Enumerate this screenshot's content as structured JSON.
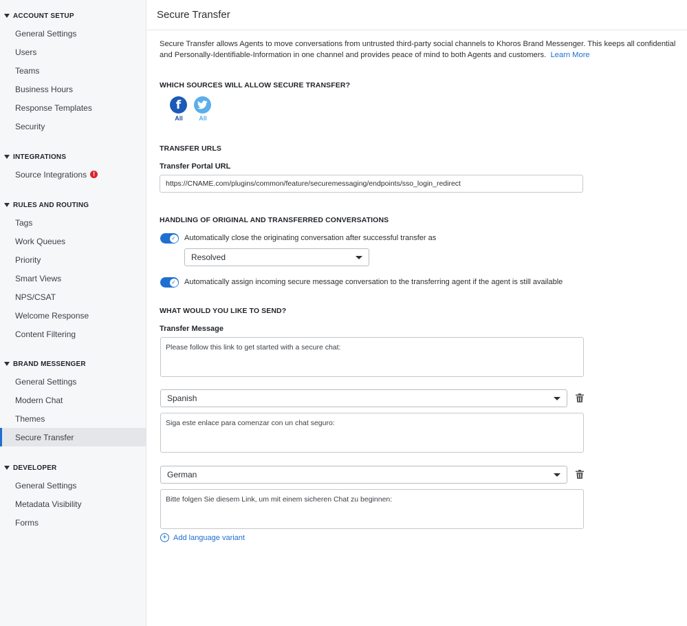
{
  "sidebar": {
    "sections": [
      {
        "title": "ACCOUNT SETUP",
        "items": [
          "General Settings",
          "Users",
          "Teams",
          "Business Hours",
          "Response Templates",
          "Security"
        ]
      },
      {
        "title": "INTEGRATIONS",
        "items": [
          "Source Integrations"
        ]
      },
      {
        "title": "RULES AND ROUTING",
        "items": [
          "Tags",
          "Work Queues",
          "Priority",
          "Smart Views",
          "NPS/CSAT",
          "Welcome Response",
          "Content Filtering"
        ]
      },
      {
        "title": "BRAND MESSENGER",
        "items": [
          "General Settings",
          "Modern Chat",
          "Themes",
          "Secure Transfer"
        ]
      },
      {
        "title": "DEVELOPER",
        "items": [
          "General Settings",
          "Metadata Visibility",
          "Forms"
        ]
      }
    ],
    "alert_glyph": "!",
    "active_item": "Secure Transfer"
  },
  "page": {
    "title": "Secure Transfer",
    "description": "Secure Transfer allows Agents to move conversations from untrusted third-party social channels to Khoros Brand Messenger. This keeps all confidential and Personally-Identifiable-Information in one channel and provides peace of mind to both Agents and customers.",
    "learn_more": "Learn More"
  },
  "sources": {
    "heading": "WHICH SOURCES WILL ALLOW SECURE TRANSFER?",
    "items": [
      {
        "icon": "facebook-icon",
        "glyph": "f",
        "caption": "All",
        "color": "#1b5ab8",
        "caption_color": "#1b4f9c"
      },
      {
        "icon": "twitter-icon",
        "glyph": "🐦",
        "caption": "All",
        "color": "#5aaeea",
        "caption_color": "#5aaeea"
      }
    ]
  },
  "transfer_urls": {
    "heading": "TRANSFER URLS",
    "portal_label": "Transfer Portal URL",
    "portal_value": "https://CNAME.com/plugins/common/feature/securemessaging/endpoints/sso_login_redirect"
  },
  "handling": {
    "heading": "HANDLING OF ORIGINAL AND TRANSFERRED CONVERSATIONS",
    "auto_close_label": "Automatically close the originating conversation after successful transfer as",
    "auto_close_on": true,
    "status_value": "Resolved",
    "auto_assign_label": "Automatically assign incoming secure message conversation to the transferring agent if the agent is still available",
    "auto_assign_on": true,
    "check_glyph": "✓"
  },
  "send": {
    "heading": "WHAT WOULD YOU LIKE TO SEND?",
    "message_label": "Transfer Message",
    "default_message": "Please follow this link to get started with a secure chat:",
    "variants": [
      {
        "language": "Spanish",
        "message": "Siga este enlace para comenzar con un chat seguro:"
      },
      {
        "language": "German",
        "message": "Bitte folgen Sie diesem Link, um mit einem sicheren Chat zu beginnen:"
      }
    ],
    "add_variant": "Add language variant",
    "add_glyph": "+"
  },
  "colors": {
    "accent": "#1f6fd1",
    "alert": "#d9262c"
  }
}
